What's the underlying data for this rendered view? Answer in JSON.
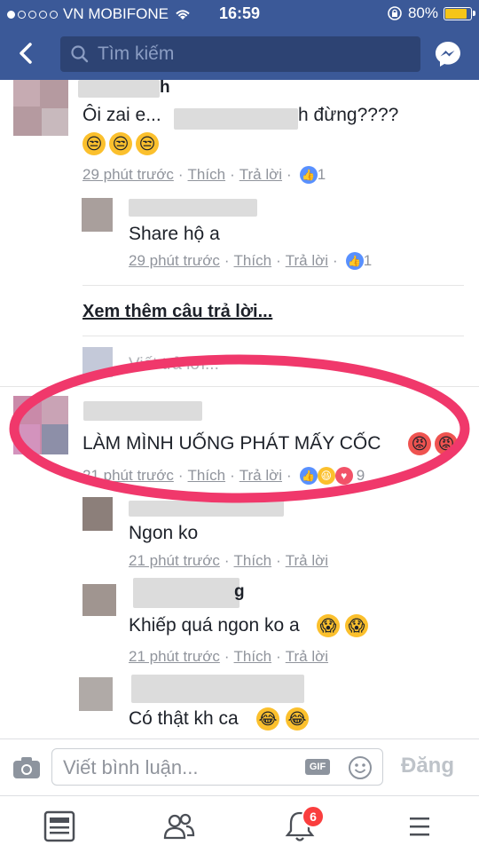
{
  "status_bar": {
    "carrier": "VN MOBIFONE",
    "time": "16:59",
    "battery": "80%"
  },
  "search": {
    "placeholder": "Tìm kiếm"
  },
  "comments": [
    {
      "author": "h",
      "text": "Ôi zai e...",
      "text_end": "h đừng????",
      "emoji": [
        "😒",
        "😒",
        "😒"
      ],
      "time": "29 phút trước",
      "like": "Thích",
      "reply": "Trả lời",
      "reaction_count": "1"
    },
    {
      "author": "",
      "text": "Share hộ a",
      "time": "29 phút trước",
      "like": "Thích",
      "reply": "Trả lời",
      "reaction_count": "1"
    }
  ],
  "more_replies": "Xem thêm câu trả lời...",
  "reply_placeholder": "Viết trả lời...",
  "highlighted_comment": {
    "text": "LÀM MÌNH UỐNG PHÁT MẤY CỐC",
    "time": "21 phút trước",
    "like": "Thích",
    "reply": "Trả lời",
    "reaction_count": "9"
  },
  "replies": [
    {
      "text": "Ngon ko",
      "time": "21 phút trước",
      "like": "Thích",
      "reply": "Trả lời"
    },
    {
      "author_partial": "g",
      "text": "Khiếp quá ngon ko a",
      "time": "21 phút trước",
      "like": "Thích",
      "reply": "Trả lời"
    },
    {
      "text": "Có thật kh ca",
      "time": "",
      "like": "",
      "reply": ""
    }
  ],
  "composer": {
    "placeholder": "Viết bình luận...",
    "gif": "GIF",
    "post": "Đăng"
  },
  "tabbar": {
    "notification_badge": "6"
  },
  "colors": {
    "brand": "#3b5998",
    "highlight_ring": "#f0386b"
  }
}
